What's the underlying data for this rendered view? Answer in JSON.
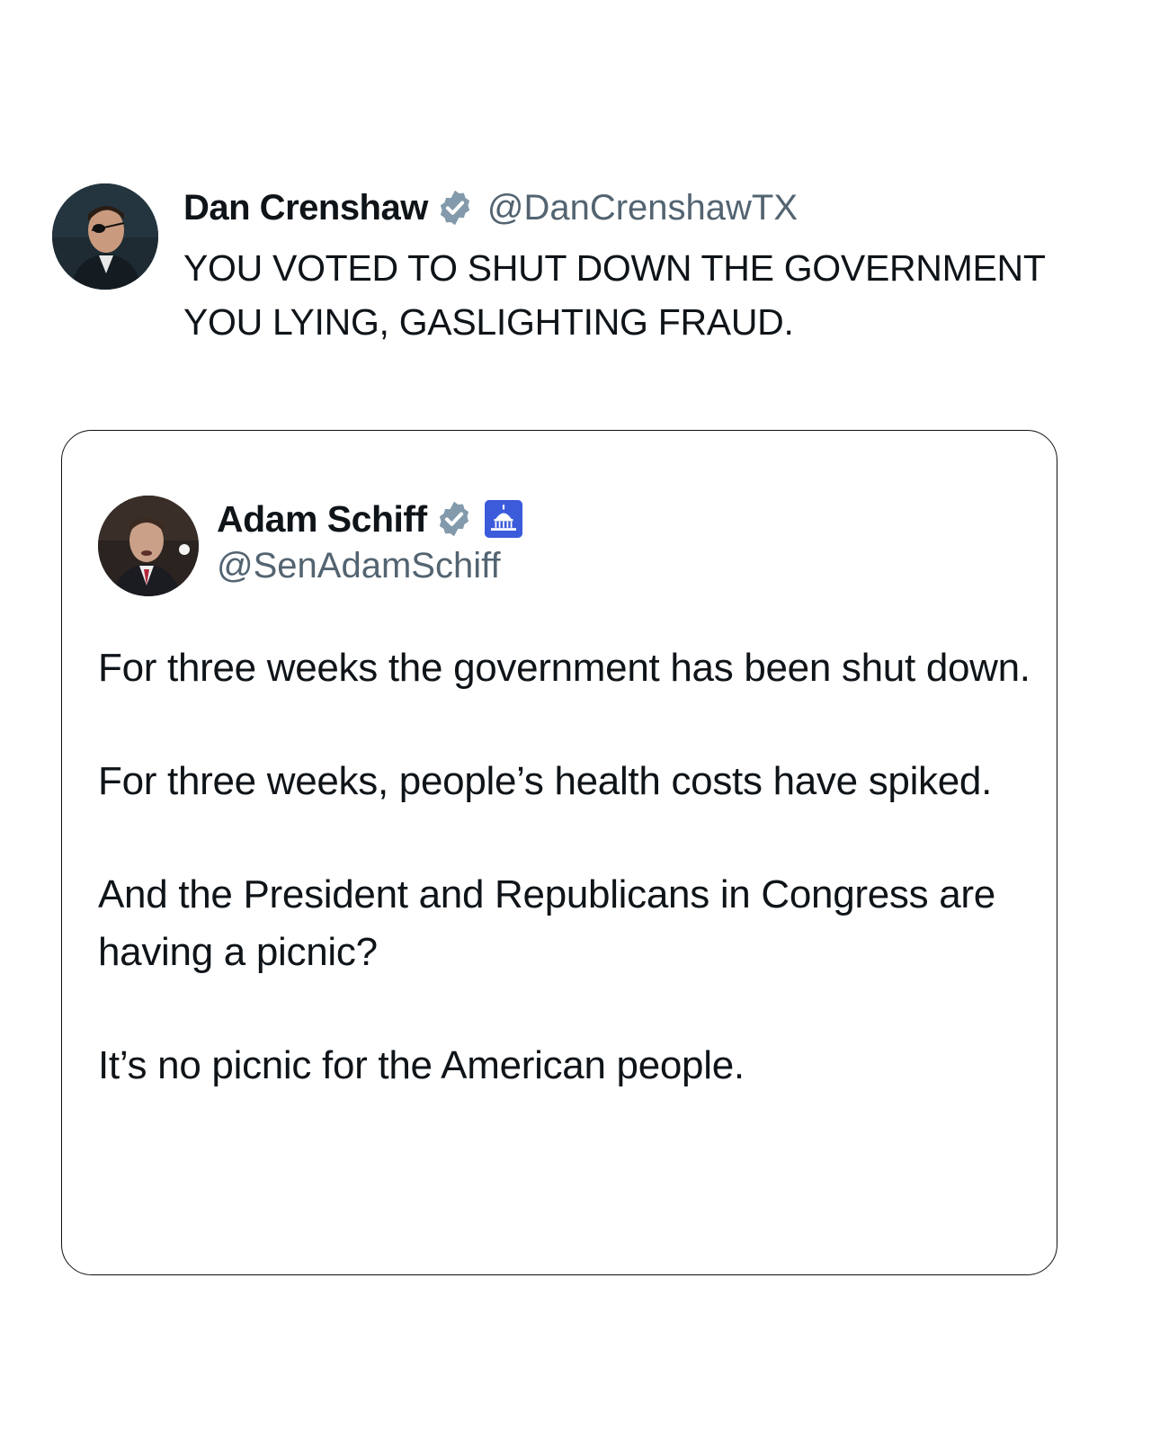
{
  "main_tweet": {
    "author_name": "Dan Crenshaw",
    "handle": "@DanCrenshawTX",
    "verified_icon": "verified-badge-icon",
    "text_line_1": "YOU VOTED TO SHUT DOWN THE GOVERNMENT",
    "text_line_2": "YOU LYING, GASLIGHTING FRAUD."
  },
  "quoted_tweet": {
    "author_name": "Adam Schiff",
    "handle": "@SenAdamSchiff",
    "verified_icon": "verified-badge-icon",
    "affiliation_icon": "capitol-building-icon",
    "paragraphs": [
      "For three weeks the government has been shut down.",
      "For three weeks, people’s health costs have spiked.",
      "And the President and Republicans in Congress are having a picnic?",
      "It’s no picnic for the American people."
    ]
  },
  "colors": {
    "text": "#0f1419",
    "muted": "#536471",
    "verified_badge": "#829aab",
    "gov_badge": "#3b5bdb",
    "border": "#111111"
  }
}
